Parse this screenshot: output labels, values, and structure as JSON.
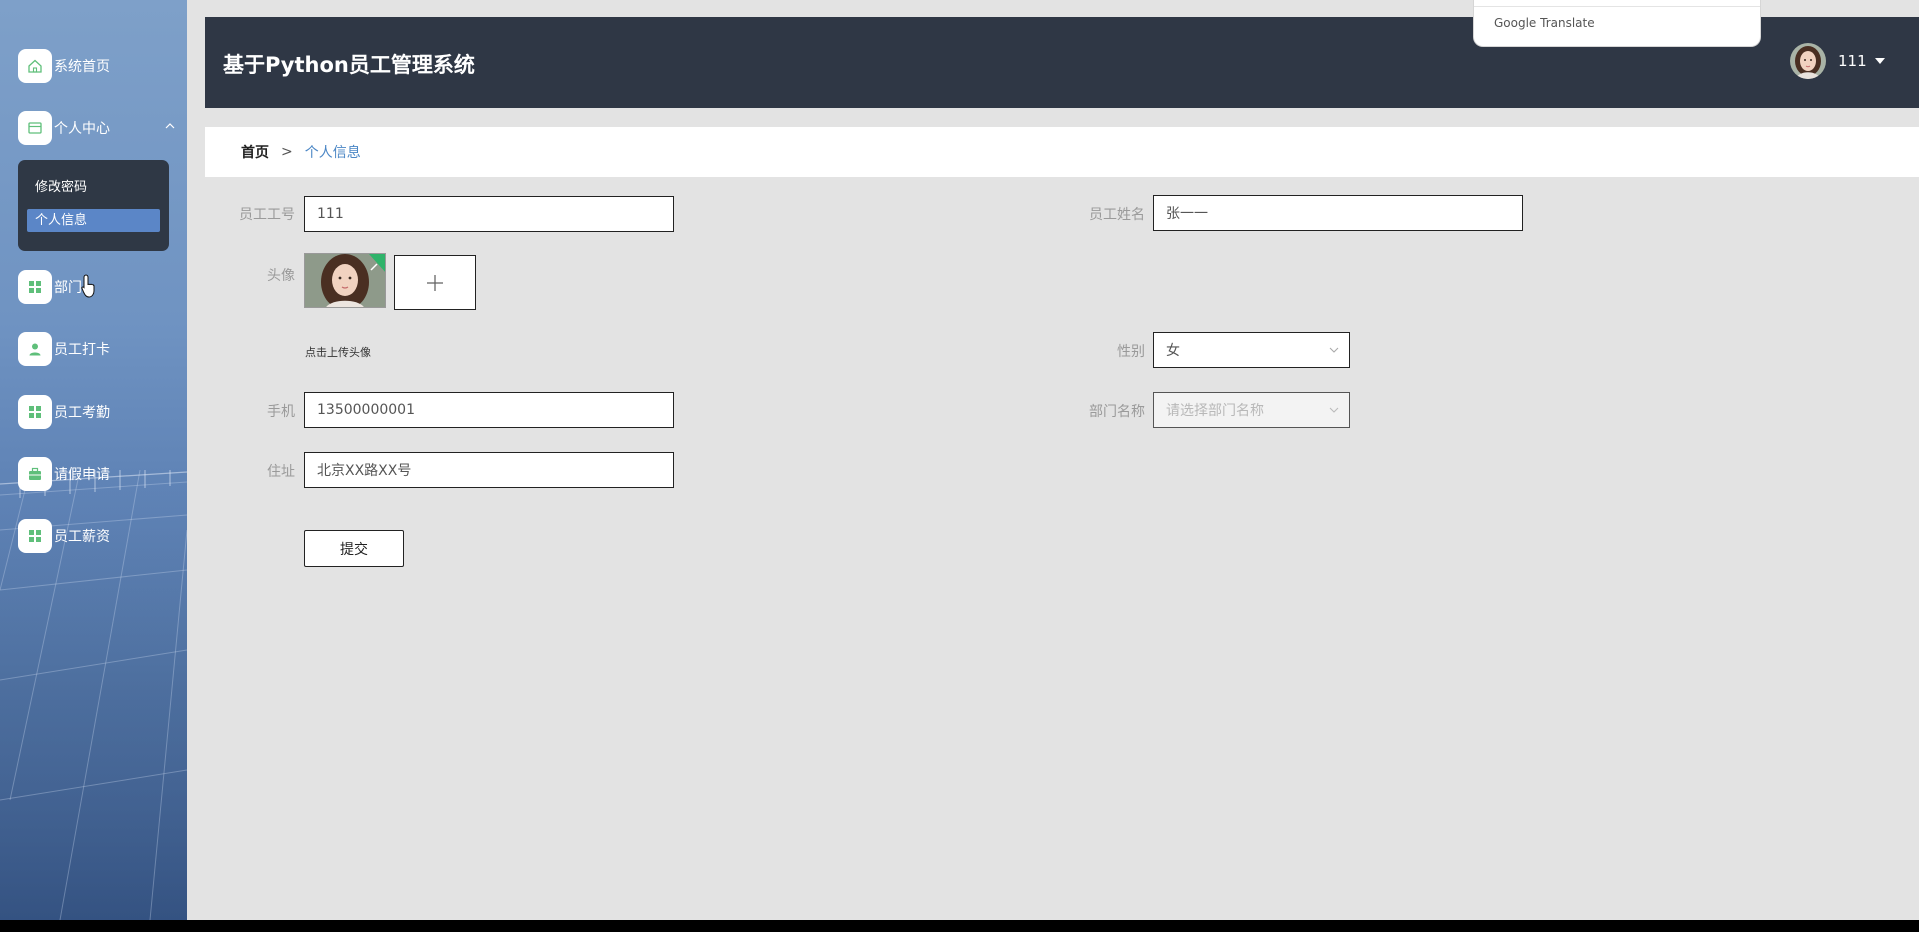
{
  "app": {
    "title": "基于Python员工管理系统"
  },
  "colors": {
    "header_bg": "#2f3745",
    "accent": "#4a86c5",
    "nav_icon": "#5fbf7a"
  },
  "sidebar": {
    "items": [
      {
        "label": "系统首页",
        "icon": "home-icon"
      },
      {
        "label": "个人中心",
        "icon": "card-icon",
        "expanded": true
      },
      {
        "label": "部门",
        "icon": "grid-icon"
      },
      {
        "label": "员工打卡",
        "icon": "user-icon"
      },
      {
        "label": "员工考勤",
        "icon": "grid-icon"
      },
      {
        "label": "请假申请",
        "icon": "briefcase-icon"
      },
      {
        "label": "员工薪资",
        "icon": "grid-icon"
      }
    ],
    "submenu": [
      {
        "label": "修改密码"
      },
      {
        "label": "个人信息",
        "active": true
      }
    ]
  },
  "header": {
    "username": "111"
  },
  "translate": {
    "label": "Google Translate"
  },
  "breadcrumb": {
    "home": "首页",
    "separator": ">",
    "current": "个人信息"
  },
  "form": {
    "employee_id": {
      "label": "员工工号",
      "value": "111"
    },
    "employee_name": {
      "label": "员工姓名",
      "value": "张一一"
    },
    "avatar": {
      "label": "头像",
      "hint": "点击上传头像"
    },
    "gender": {
      "label": "性别",
      "value": "女"
    },
    "phone": {
      "label": "手机",
      "value": "13500000001"
    },
    "department": {
      "label": "部门名称",
      "placeholder": "请选择部门名称"
    },
    "address": {
      "label": "住址",
      "value": "北京XX路XX号"
    },
    "submit_label": "提交"
  }
}
